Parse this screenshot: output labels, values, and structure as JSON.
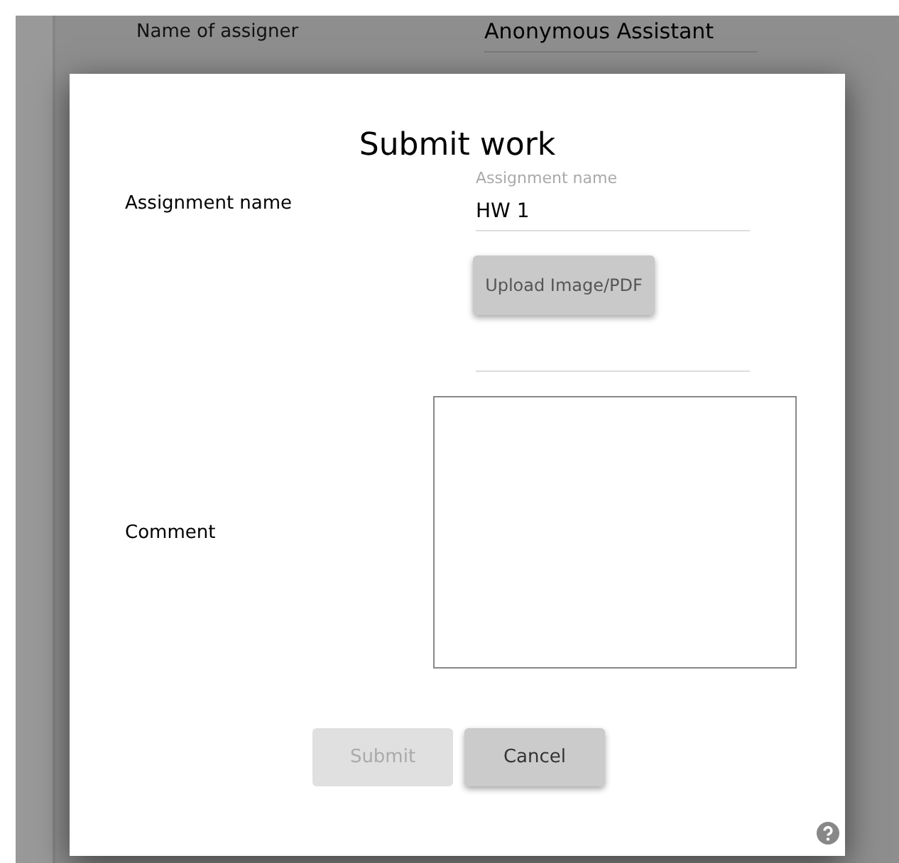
{
  "background_form": {
    "label": "Name of assigner",
    "value": "Anonymous Assistant"
  },
  "dialog": {
    "title": "Submit work",
    "assignment": {
      "label": "Assignment name",
      "floating_label": "Assignment name",
      "value": "HW 1"
    },
    "upload_button": {
      "label": "Upload Image/PDF"
    },
    "comment": {
      "label": "Comment"
    },
    "buttons": [
      {
        "label": "Submit",
        "disabled": true
      },
      {
        "label": "Cancel",
        "disabled": false
      }
    ]
  }
}
